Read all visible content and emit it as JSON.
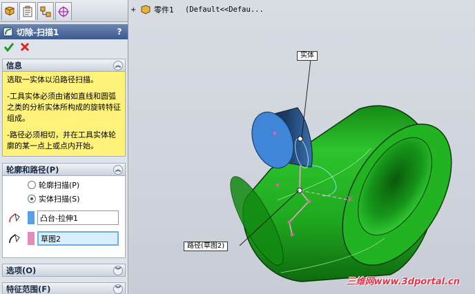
{
  "tabs": [
    {
      "name": "feature-manager",
      "icon": "feature-tree-icon"
    },
    {
      "name": "property-manager",
      "icon": "property-sheet-icon"
    },
    {
      "name": "configuration-manager",
      "icon": "configuration-icon"
    },
    {
      "name": "appearance-manager",
      "icon": "target-icon"
    }
  ],
  "feature": {
    "title": "切除-扫描1",
    "help": "?",
    "ok_icon": "checkmark-icon",
    "cancel_icon": "x-icon"
  },
  "info": {
    "header": "信息",
    "paragraphs": [
      "选取一实体以沿路径扫描。",
      "-工具实体必须由诸如直线和圆弧之类的分析实体所构成的旋转特征组成。",
      "-路径必须相切，并在工具实体轮廓的某一点上或点内开始。"
    ]
  },
  "profile_path": {
    "header": "轮廓和路径(P)",
    "radio_profile": "轮廓扫描(P)",
    "radio_solid": "实体扫描(S)",
    "selected_radio": "solid",
    "solid_field": "凸台-拉伸1",
    "solid_color": "#5aa0e6",
    "path_field": "草图2",
    "path_color": "#e28ab8"
  },
  "options": {
    "header": "选项(O)"
  },
  "feature_scope": {
    "header": "特征范围(F)"
  },
  "tree": {
    "part_label": "零件1",
    "config_label": "(Default<<Defau..."
  },
  "callouts": {
    "solid": "实体",
    "path": "路径(草图2)"
  },
  "watermark": "三维网www.3dportal.cn",
  "colors": {
    "accent": "#3c5a8f",
    "cylinder": "#1fa81f",
    "tool_body": "#3f86d8",
    "info_bg": "#fff27a"
  }
}
